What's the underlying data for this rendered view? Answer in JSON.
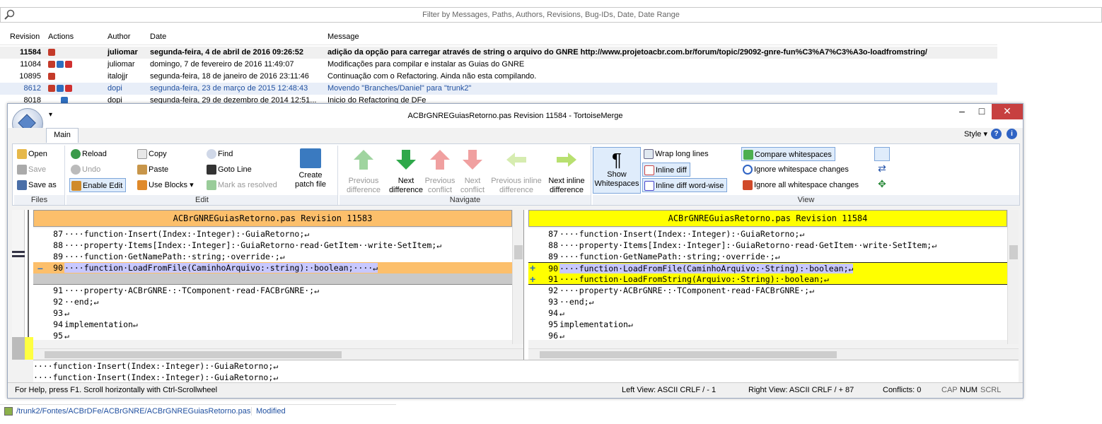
{
  "filter": {
    "placeholder": "Filter by Messages, Paths, Authors, Revisions, Bug-IDs, Date, Date Range"
  },
  "log": {
    "columns": [
      "Revision",
      "Actions",
      "Author",
      "Date",
      "Message"
    ],
    "rows": [
      {
        "rev": "11584",
        "author": "juliomar",
        "date": "segunda-feira, 4 de abril de 2016 09:26:52",
        "message": "adição da opção para carregar através de string o arquivo do GNRE http://www.projetoacbr.com.br/forum/topic/29092-gnre-fun%C3%A7%C3%A3o-loadfromstring/"
      },
      {
        "rev": "11084",
        "author": "juliomar",
        "date": "domingo, 7 de fevereiro de 2016 11:49:07",
        "message": "Modificações para compilar e instalar as Guias do GNRE"
      },
      {
        "rev": "10895",
        "author": "italojjr",
        "date": "segunda-feira, 18 de janeiro de 2016 23:11:46",
        "message": "Continuação com o Refactoring. Ainda não esta compilando."
      },
      {
        "rev": "8612",
        "author": "dopi",
        "date": "segunda-feira, 23 de março de 2015 12:48:43",
        "message": "Movendo \"Branches/Daniel\" para \"trunk2\""
      },
      {
        "rev": "8018",
        "author": "dopi",
        "date": "segunda-feira, 29 de dezembro de 2014 12:51...",
        "message": "Inicio do Refactoring de DFe"
      }
    ],
    "bottom_path": "/trunk2/Fontes/ACBrDFe/ACBrGNRE/ACBrGNREGuiasRetorno.pas",
    "bottom_action": "Modified"
  },
  "window": {
    "title": "ACBrGNREGuiasRetorno.pas Revision 11584 - TortoiseMerge",
    "tab": "Main",
    "style_label": "Style"
  },
  "ribbon": {
    "files": {
      "title": "Files",
      "open": "Open",
      "save": "Save",
      "save_as": "Save as"
    },
    "edit": {
      "title": "Edit",
      "reload": "Reload",
      "undo": "Undo",
      "enable_edit": "Enable Edit",
      "copy": "Copy",
      "paste": "Paste",
      "use_blocks": "Use Blocks",
      "find": "Find",
      "goto_line": "Goto Line",
      "mark_resolved": "Mark as resolved",
      "create_patch_1": "Create",
      "create_patch_2": "patch file"
    },
    "navigate": {
      "title": "Navigate",
      "prev_diff_1": "Previous",
      "prev_diff_2": "difference",
      "next_diff_1": "Next",
      "next_diff_2": "difference",
      "prev_conf_1": "Previous",
      "prev_conf_2": "conflict",
      "next_conf_1": "Next",
      "next_conf_2": "conflict",
      "prev_inline_1": "Previous inline",
      "prev_inline_2": "difference",
      "next_inline_1": "Next inline",
      "next_inline_2": "difference"
    },
    "view": {
      "title": "View",
      "show_ws_1": "Show",
      "show_ws_2": "Whitespaces",
      "wrap": "Wrap long lines",
      "inline_diff": "Inline diff",
      "inline_word": "Inline diff word-wise",
      "compare_ws": "Compare whitespaces",
      "ignore_ws": "Ignore whitespace changes",
      "ignore_all_ws": "Ignore all whitespace changes"
    }
  },
  "left": {
    "header": "ACBrGNREGuiasRetorno.pas Revision 11583",
    "lines": [
      {
        "n": "87",
        "t": "····function·Insert(Index:·Integer):·GuiaRetorno;↵"
      },
      {
        "n": "88",
        "t": "····property·Items[Index:·Integer]:·GuiaRetorno·read·GetItem··write·SetItem;↵"
      },
      {
        "n": "89",
        "t": "····function·GetNamePath:·string;·override·;↵"
      },
      {
        "n": "90",
        "t": "····function·LoadFromFile(CaminhoArquivo:·string):·boolean;····↵"
      },
      {
        "n": "",
        "t": ""
      },
      {
        "n": "91",
        "t": "····property·ACBrGNRE·:·TComponent·read·FACBrGNRE·;↵"
      },
      {
        "n": "92",
        "t": "··end;↵"
      },
      {
        "n": "93",
        "t": "↵"
      },
      {
        "n": "94",
        "t": "implementation↵"
      },
      {
        "n": "95",
        "t": "↵"
      }
    ]
  },
  "right": {
    "header": "ACBrGNREGuiasRetorno.pas Revision 11584",
    "lines": [
      {
        "n": "87",
        "t": "····function·Insert(Index:·Integer):·GuiaRetorno;↵"
      },
      {
        "n": "88",
        "t": "····property·Items[Index:·Integer]:·GuiaRetorno·read·GetItem··write·SetItem;↵"
      },
      {
        "n": "89",
        "t": "····function·GetNamePath:·string;·override·;↵"
      },
      {
        "n": "90",
        "t": "····function·LoadFromFile(CaminhoArquivo:·String):·boolean;↵"
      },
      {
        "n": "91",
        "t": "····function·LoadFromString(Arquivo:·String):·boolean;↵"
      },
      {
        "n": "92",
        "t": "····property·ACBrGNRE·:·TComponent·read·FACBrGNRE·;↵"
      },
      {
        "n": "93",
        "t": "··end;↵"
      },
      {
        "n": "94",
        "t": "↵"
      },
      {
        "n": "95",
        "t": "implementation↵"
      },
      {
        "n": "96",
        "t": "↵"
      }
    ]
  },
  "bottom": {
    "line1": "····function·Insert(Index:·Integer):·GuiaRetorno;↵",
    "line2": "····function·Insert(Index:·Integer):·GuiaRetorno;↵"
  },
  "status": {
    "help": "For Help, press F1. Scroll horizontally with Ctrl-Scrollwheel",
    "left_view": "Left View: ASCII CRLF  / - 1",
    "right_view": "Right View: ASCII CRLF  / + 87",
    "conflicts": "Conflicts: 0",
    "cap": "CAP",
    "num": "NUM",
    "scrl": "SCRL"
  },
  "colors": {
    "changed": "#fcbf6b",
    "added": "#ffff00",
    "removed_word": "#d06060",
    "accent": "#2f63c4",
    "close": "#c74040"
  }
}
